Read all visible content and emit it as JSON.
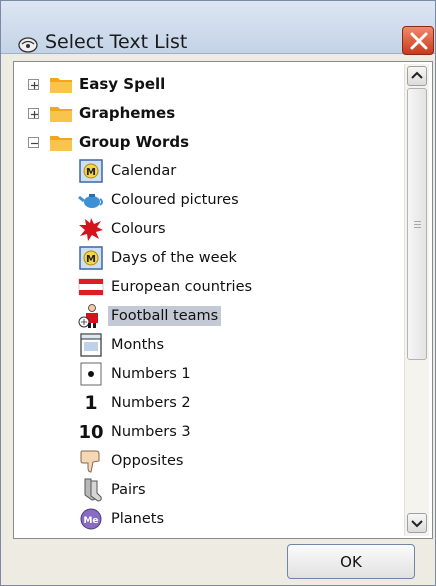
{
  "dialog": {
    "title": "Select Text List",
    "close_label": "close",
    "ok_label": "OK"
  },
  "tree": {
    "folders": [
      {
        "label": "Easy Spell",
        "expanded": false
      },
      {
        "label": "Graphemes",
        "expanded": false
      },
      {
        "label": "Group Words",
        "expanded": true
      }
    ],
    "items": [
      {
        "label": "Calendar",
        "icon": "calendar-icon"
      },
      {
        "label": "Coloured pictures",
        "icon": "teapot-icon"
      },
      {
        "label": "Colours",
        "icon": "paint-splat-icon"
      },
      {
        "label": "Days of the week",
        "icon": "calendar-icon"
      },
      {
        "label": "European countries",
        "icon": "flag-icon"
      },
      {
        "label": "Football teams",
        "icon": "football-player-icon",
        "selected": true
      },
      {
        "label": "Months",
        "icon": "month-calendar-icon"
      },
      {
        "label": "Numbers 1",
        "icon": "dot-card-icon"
      },
      {
        "label": "Numbers 2",
        "icon": "number-one-icon",
        "glyph": "1"
      },
      {
        "label": "Numbers 3",
        "icon": "number-ten-icon",
        "glyph": "10"
      },
      {
        "label": "Opposites",
        "icon": "thumbs-down-icon"
      },
      {
        "label": "Pairs",
        "icon": "socks-icon"
      },
      {
        "label": "Planets",
        "icon": "planet-icon"
      }
    ]
  },
  "colors": {
    "selection": "#c4c9d6",
    "folder": "#f5b324",
    "close_button": "#d84a2a"
  }
}
